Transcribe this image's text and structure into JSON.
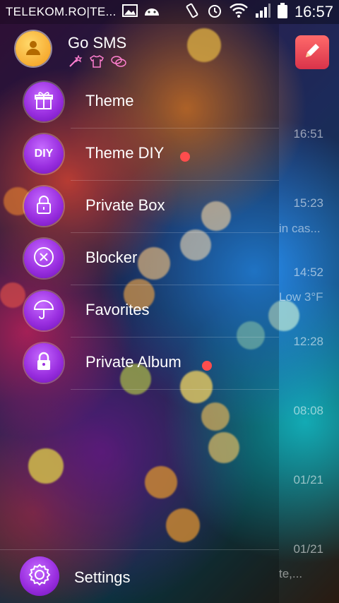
{
  "status_bar": {
    "carrier": "TELEKOM.RO|TE...",
    "clock": "16:57",
    "icons": [
      "image-icon",
      "android-icon",
      "vibrate-icon",
      "alarm-icon",
      "wifi-icon",
      "signal-icon",
      "battery-icon"
    ]
  },
  "drawer": {
    "app_name": "Go SMS",
    "header_icons": [
      "magic-wand-icon",
      "tshirt-icon",
      "chat-bubbles-icon"
    ],
    "items": [
      {
        "label": "Theme",
        "icon": "gift-icon",
        "badge": false
      },
      {
        "label": "Theme DIY",
        "icon": "diy-icon",
        "icon_text": "DIY",
        "badge": true
      },
      {
        "label": "Private Box",
        "icon": "lock-icon",
        "badge": false
      },
      {
        "label": "Blocker",
        "icon": "block-x-icon",
        "badge": false
      },
      {
        "label": "Favorites",
        "icon": "umbrella-icon",
        "badge": false
      },
      {
        "label": "Private Album",
        "icon": "padlock-icon",
        "badge": true
      }
    ],
    "settings_label": "Settings"
  },
  "background_list": {
    "times": [
      "16:51",
      "15:23",
      "14:52",
      "12:28",
      "08:08",
      "01/21",
      "01/21"
    ],
    "snippets": [
      "in cas...",
      "Low 3°F",
      "te,..."
    ]
  },
  "colors": {
    "accent_purple": "#9a2fe0",
    "badge_red": "#ff4d4d",
    "compose_red": "#d9334a"
  }
}
